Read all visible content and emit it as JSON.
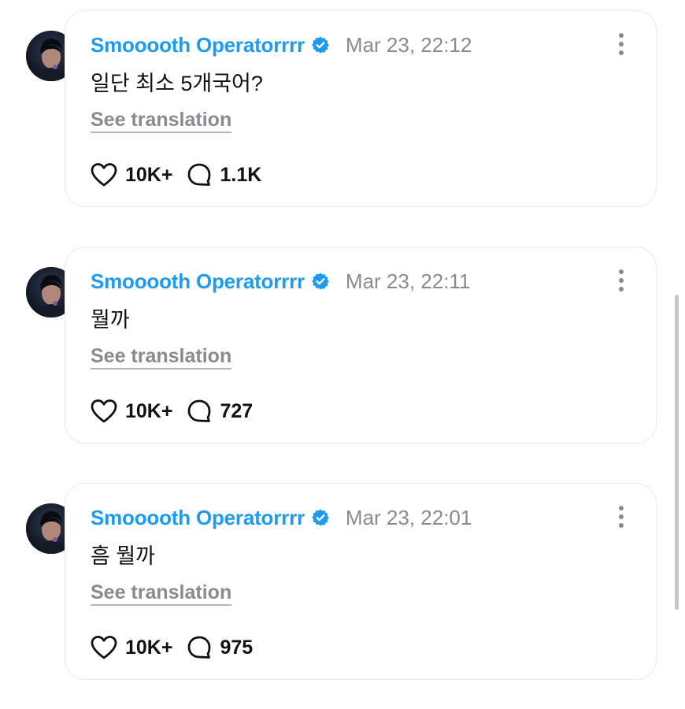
{
  "colors": {
    "name": "#1d9bf0",
    "verified": "#1d9bf0",
    "muted": "#8a8a8f",
    "text": "#111111",
    "card_border": "#e9e9ee"
  },
  "posts": [
    {
      "author": "Smooooth Operatorrrr",
      "timestamp": "Mar 23, 22:12",
      "text": "일단 최소 5개국어?",
      "translate_label": "See translation",
      "likes": "10K+",
      "replies": "1.1K"
    },
    {
      "author": "Smooooth Operatorrrr",
      "timestamp": "Mar 23, 22:11",
      "text": "뭘까",
      "translate_label": "See translation",
      "likes": "10K+",
      "replies": "727"
    },
    {
      "author": "Smooooth Operatorrrr",
      "timestamp": "Mar 23, 22:01",
      "text": "흠 뭘까",
      "translate_label": "See translation",
      "likes": "10K+",
      "replies": "975"
    }
  ],
  "icons": {
    "verified": "verified-badge-icon",
    "like": "heart-icon",
    "reply": "speech-bubble-icon",
    "more": "more-options-icon"
  }
}
